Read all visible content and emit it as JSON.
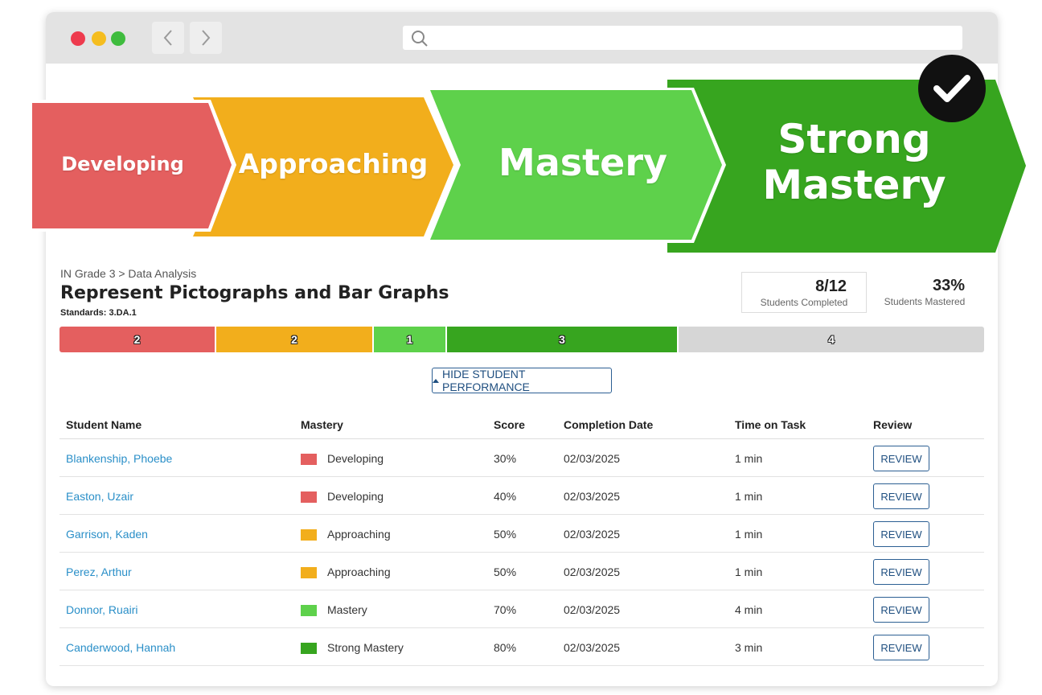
{
  "colors": {
    "developing": "#e45f5f",
    "approaching": "#f2ae1c",
    "mastery": "#5ed14b",
    "strong_mastery": "#37a51f",
    "incomplete": "#d6d6d6"
  },
  "banner": {
    "levels": [
      {
        "label": "Developing"
      },
      {
        "label": "Approaching"
      },
      {
        "label": "Mastery"
      },
      {
        "label_line1": "Strong",
        "label_line2": "Mastery"
      }
    ],
    "badge_icon": "checkmark-icon"
  },
  "browser": {
    "back_icon": "chevron-left-icon",
    "forward_icon": "chevron-right-icon",
    "search_icon": "search-icon",
    "address_value": ""
  },
  "header": {
    "breadcrumb": "IN Grade 3 > Data Analysis",
    "title": "Represent Pictographs and Bar Graphs",
    "standards": "Standards: 3.DA.1"
  },
  "stats": {
    "completed_value": "8/12",
    "completed_label": "Students Completed",
    "mastered_value": "33%",
    "mastered_label": "Students Mastered"
  },
  "distribution": [
    {
      "count": "2",
      "level": "developing"
    },
    {
      "count": "2",
      "level": "approaching"
    },
    {
      "count": "1",
      "level": "mastery"
    },
    {
      "count": "3",
      "level": "strong_mastery"
    },
    {
      "count": "4",
      "level": "incomplete"
    }
  ],
  "toggle_label": "HIDE STUDENT PERFORMANCE",
  "table": {
    "columns": [
      "Student Name",
      "Mastery",
      "Score",
      "Completion Date",
      "Time on Task",
      "Review"
    ],
    "review_label": "REVIEW",
    "rows": [
      {
        "name": "Blankenship, Phoebe",
        "mastery": "Developing",
        "level": "developing",
        "score": "30%",
        "date": "02/03/2025",
        "time": "1 min"
      },
      {
        "name": "Easton, Uzair",
        "mastery": "Developing",
        "level": "developing",
        "score": "40%",
        "date": "02/03/2025",
        "time": "1 min"
      },
      {
        "name": "Garrison, Kaden",
        "mastery": "Approaching",
        "level": "approaching",
        "score": "50%",
        "date": "02/03/2025",
        "time": "1 min"
      },
      {
        "name": "Perez, Arthur",
        "mastery": "Approaching",
        "level": "approaching",
        "score": "50%",
        "date": "02/03/2025",
        "time": "1 min"
      },
      {
        "name": "Donnor, Ruairi",
        "mastery": "Mastery",
        "level": "mastery",
        "score": "70%",
        "date": "02/03/2025",
        "time": "4 min"
      },
      {
        "name": "Canderwood, Hannah",
        "mastery": "Strong Mastery",
        "level": "strong_mastery",
        "score": "80%",
        "date": "02/03/2025",
        "time": "3 min"
      }
    ]
  }
}
